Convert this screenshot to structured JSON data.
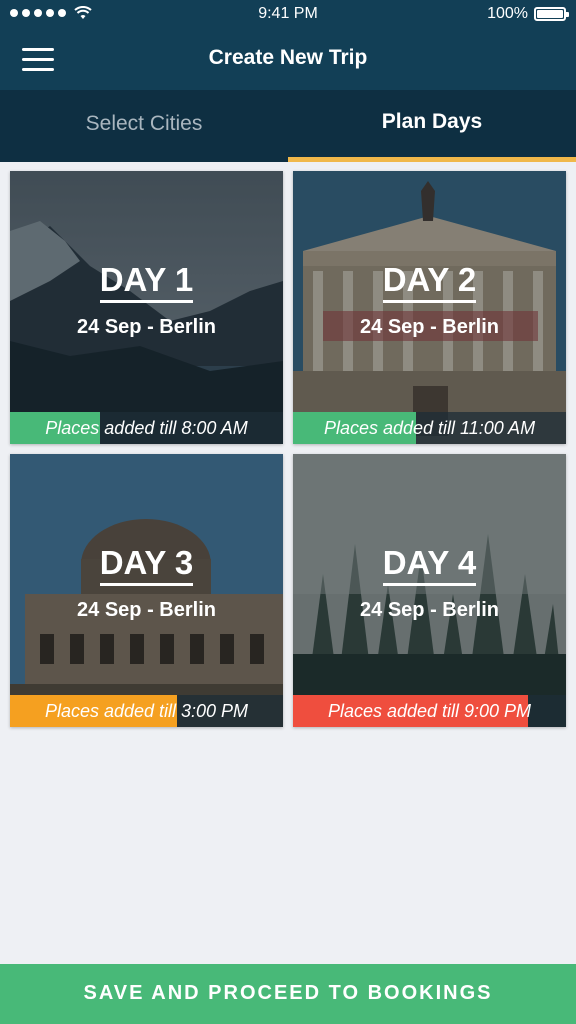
{
  "status_bar": {
    "time": "9:41 PM",
    "battery": "100%"
  },
  "nav": {
    "title": "Create New Trip"
  },
  "tabs": [
    {
      "label": "Select Cities",
      "active": false
    },
    {
      "label": "Plan Days",
      "active": true
    }
  ],
  "days": [
    {
      "title": "DAY 1",
      "subtitle": "24 Sep - Berlin",
      "status": "Places added till 8:00 AM",
      "progress": 0.33,
      "bar_color": "#48b978"
    },
    {
      "title": "DAY 2",
      "subtitle": "24 Sep - Berlin",
      "status": "Places added till 11:00 AM",
      "progress": 0.45,
      "bar_color": "#48b978"
    },
    {
      "title": "DAY 3",
      "subtitle": "24 Sep - Berlin",
      "status": "Places added till 3:00 PM",
      "progress": 0.61,
      "bar_color": "#f5a020"
    },
    {
      "title": "DAY 4",
      "subtitle": "24 Sep - Berlin",
      "status": "Places added till 9:00 PM",
      "progress": 0.86,
      "bar_color": "#ef4e3e"
    }
  ],
  "footer": {
    "button_label": "SAVE AND PROCEED TO BOOKINGS"
  },
  "colors": {
    "header": "#123f56",
    "tabs": "#0e2f42",
    "tab_indicator": "#f0b84a",
    "primary": "#48b978"
  },
  "icons": {
    "menu": "hamburger-menu-icon",
    "wifi": "wifi-icon",
    "battery": "battery-icon"
  }
}
